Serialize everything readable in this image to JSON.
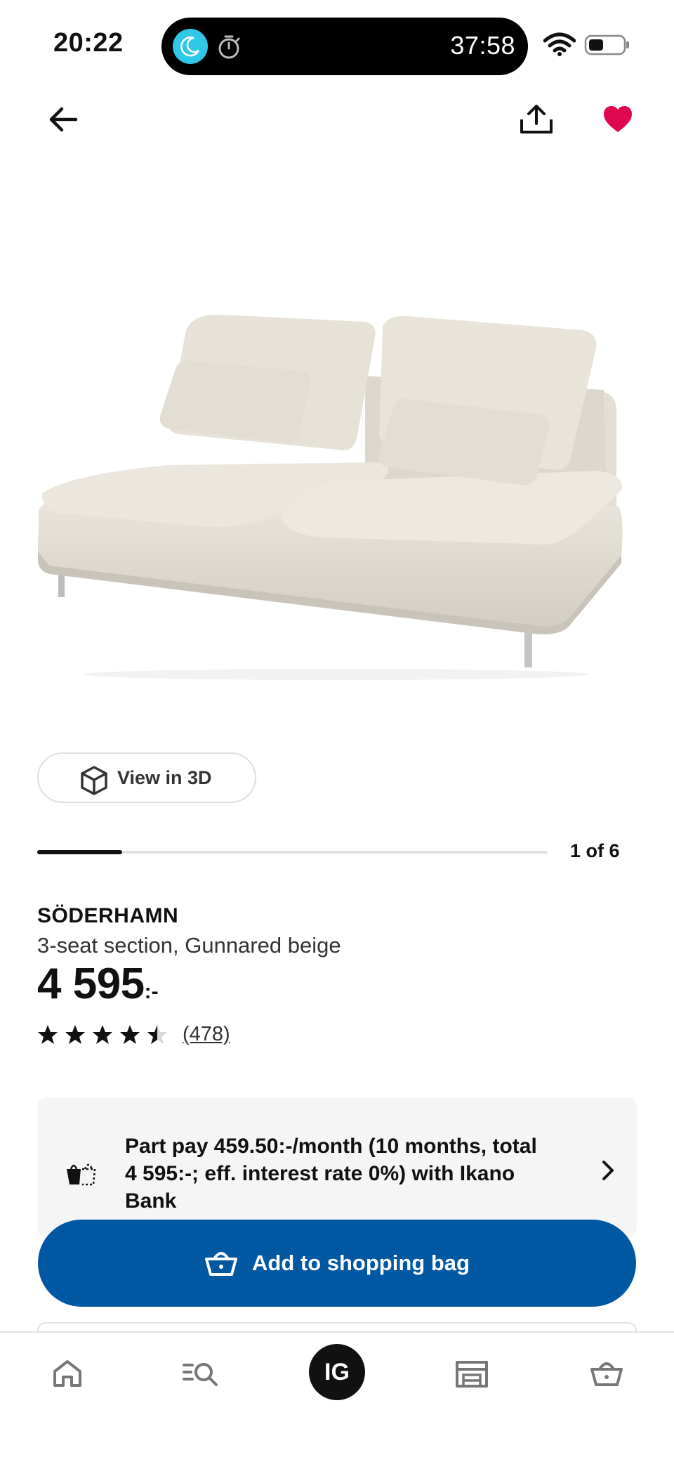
{
  "status_bar": {
    "time": "20:22",
    "timer": "37:58"
  },
  "nav": {
    "back_icon": "arrow-left-icon",
    "share_icon": "share-icon",
    "favorite_icon": "heart-filled-icon",
    "favorite_color": "#e00751"
  },
  "gallery": {
    "view_3d_label": "View in 3D",
    "counter": "1 of 6",
    "progress_fraction": 0.1667
  },
  "product": {
    "name": "SÖDERHAMN",
    "description": "3-seat section, Gunnared beige",
    "price": "4 595",
    "price_suffix": ":-",
    "rating_stars": 4.5,
    "rating_count": "(478)"
  },
  "part_pay": {
    "text": "Part pay 459.50:-/month (10 months, total 4 595:-; eff. interest rate 0%) with Ikano Bank"
  },
  "cta": {
    "add_to_bag_label": "Add to shopping bag",
    "color": "#0058a3"
  },
  "tabbar": {
    "home_icon": "home-icon",
    "search_icon": "search-icon",
    "profile_initials": "IG",
    "store_icon": "store-icon",
    "bag_icon": "basket-icon"
  }
}
